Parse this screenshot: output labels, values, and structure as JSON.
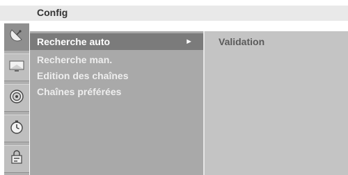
{
  "header": {
    "title": "Config"
  },
  "sidebar": {
    "items": [
      {
        "icon": "satellite-dish-icon",
        "active": true
      },
      {
        "icon": "tv-screen-icon",
        "active": false
      },
      {
        "icon": "speaker-icon",
        "active": false
      },
      {
        "icon": "clock-icon",
        "active": false
      },
      {
        "icon": "lock-settings-icon",
        "active": false
      }
    ]
  },
  "menu": {
    "items": [
      {
        "label": "Recherche auto",
        "selected": true
      },
      {
        "label": "Recherche man.",
        "selected": false
      },
      {
        "label": "Edition des chaînes",
        "selected": false
      },
      {
        "label": "Chaînes préférées",
        "selected": false
      }
    ],
    "submenu_arrow": "►"
  },
  "right_panel": {
    "label": "Validation"
  },
  "colors": {
    "selected_bg": "#7b7b7b",
    "menu_bg": "#a9a9a9",
    "panel_bg": "#c4c4c4",
    "header_bg": "#e9e9e9"
  }
}
